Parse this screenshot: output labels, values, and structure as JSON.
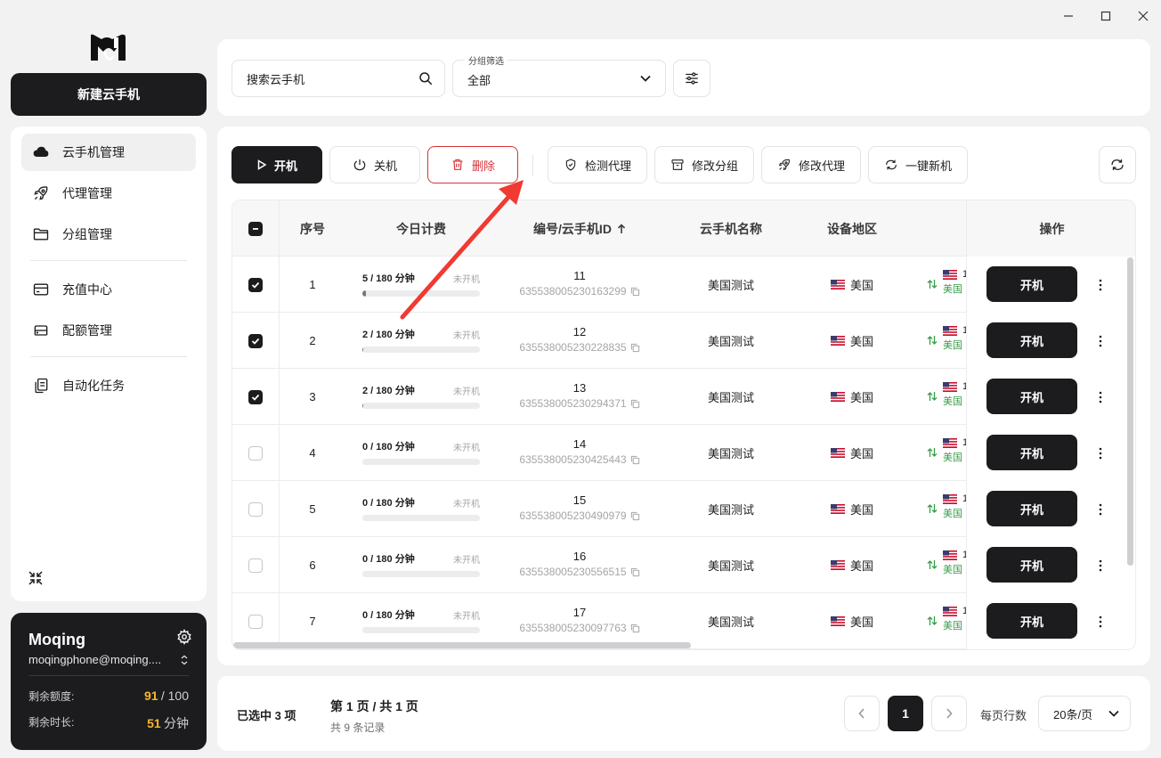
{
  "sidebar": {
    "new_button": "新建云手机",
    "items": [
      {
        "label": "云手机管理",
        "icon": "cloud-icon"
      },
      {
        "label": "代理管理",
        "icon": "rocket-icon"
      },
      {
        "label": "分组管理",
        "icon": "folder-icon"
      },
      {
        "label": "充值中心",
        "icon": "credit-card-icon"
      },
      {
        "label": "配额管理",
        "icon": "storage-icon"
      },
      {
        "label": "自动化任务",
        "icon": "clipboard-icon"
      }
    ]
  },
  "user": {
    "name": "Moqing",
    "email": "moqingphone@moqing....",
    "quota_label": "剩余额度:",
    "quota_used": "91",
    "quota_total": "/ 100",
    "time_label": "剩余时长:",
    "time_value": "51",
    "time_unit": "分钟"
  },
  "filter": {
    "search_placeholder": "搜索云手机",
    "group_label": "分组筛选",
    "group_value": "全部"
  },
  "toolbar": {
    "start": "开机",
    "stop": "关机",
    "delete": "删除",
    "check_proxy": "检测代理",
    "edit_group": "修改分组",
    "edit_proxy": "修改代理",
    "one_click_new": "一键新机"
  },
  "table": {
    "headers": {
      "index": "序号",
      "fee": "今日计费",
      "id": "编号/云手机ID",
      "name": "云手机名称",
      "region": "设备地区",
      "ops": "操作"
    },
    "op_button": "开机",
    "rows": [
      {
        "index": "1",
        "fee": "5 / 180 分钟",
        "fee_fraction": 0.028,
        "status": "未开机",
        "num": "11",
        "cid": "635538005230163299",
        "name": "美国测试",
        "region": "美国",
        "net_a": "1",
        "net_b": "美国",
        "checked": true
      },
      {
        "index": "2",
        "fee": "2 / 180 分钟",
        "fee_fraction": 0.011,
        "status": "未开机",
        "num": "12",
        "cid": "635538005230228835",
        "name": "美国测试",
        "region": "美国",
        "net_a": "1",
        "net_b": "美国",
        "checked": true
      },
      {
        "index": "3",
        "fee": "2 / 180 分钟",
        "fee_fraction": 0.011,
        "status": "未开机",
        "num": "13",
        "cid": "635538005230294371",
        "name": "美国测试",
        "region": "美国",
        "net_a": "1",
        "net_b": "美国",
        "checked": true
      },
      {
        "index": "4",
        "fee": "0 / 180 分钟",
        "fee_fraction": 0,
        "status": "未开机",
        "num": "14",
        "cid": "635538005230425443",
        "name": "美国测试",
        "region": "美国",
        "net_a": "1",
        "net_b": "美国",
        "checked": false
      },
      {
        "index": "5",
        "fee": "0 / 180 分钟",
        "fee_fraction": 0,
        "status": "未开机",
        "num": "15",
        "cid": "635538005230490979",
        "name": "美国测试",
        "region": "美国",
        "net_a": "1",
        "net_b": "美国",
        "checked": false
      },
      {
        "index": "6",
        "fee": "0 / 180 分钟",
        "fee_fraction": 0,
        "status": "未开机",
        "num": "16",
        "cid": "635538005230556515",
        "name": "美国测试",
        "region": "美国",
        "net_a": "1",
        "net_b": "美国",
        "checked": false
      },
      {
        "index": "7",
        "fee": "0 / 180 分钟",
        "fee_fraction": 0,
        "status": "未开机",
        "num": "17",
        "cid": "635538005230097763",
        "name": "美国测试",
        "region": "美国",
        "net_a": "1",
        "net_b": "美国",
        "checked": false
      }
    ]
  },
  "footer": {
    "selected": "已选中 3 项",
    "page_info": "第 1 页 / 共 1 页",
    "record_info": "共 9 条记录",
    "current_page": "1",
    "rows_label": "每页行数",
    "rows_value": "20条/页"
  },
  "colors": {
    "accent_dark": "#1c1c1e",
    "danger": "#d8333a",
    "quota_highlight": "#f5b82e",
    "annotation_arrow": "#f03a32"
  }
}
